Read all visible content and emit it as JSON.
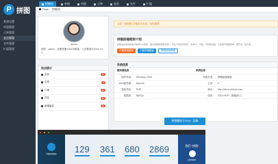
{
  "brand": {
    "name": "拼图"
  },
  "nav": [
    {
      "label": "控制台",
      "active": true
    },
    {
      "label": "系统",
      "active": false
    },
    {
      "label": "内容",
      "active": false
    },
    {
      "label": "订单",
      "active": false
    },
    {
      "label": "会员",
      "active": false
    },
    {
      "label": "文件",
      "active": false
    },
    {
      "label": "扩展",
      "active": false
    }
  ],
  "sidebar": [
    {
      "label": "系统设置",
      "active": false
    },
    {
      "label": "内容管理",
      "active": false
    },
    {
      "label": "订单管理",
      "active": false
    },
    {
      "label": "会员管理",
      "active": true
    },
    {
      "label": "文件管理",
      "active": false
    },
    {
      "label": "扩展管理",
      "active": false
    }
  ],
  "tabs": [
    {
      "label": "Plate"
    },
    {
      "label": "控制台"
    }
  ],
  "user": {
    "name": "admin",
    "welcome": "您好，admin，这是您第1000次登录，上次登录为2014-10-1。"
  },
  "stats": {
    "title": "站点统计",
    "rows": [
      {
        "label": "会员",
        "badge": "99"
      },
      {
        "label": "文章",
        "badge": "8"
      },
      {
        "label": "订单",
        "badge": "88"
      },
      {
        "label": "评论",
        "badge": "99"
      },
      {
        "label": "新增留言",
        "badge": "99"
      }
    ]
  },
  "notice": "注意：您是第1次使用本系统，祝您愉快。",
  "intro": {
    "title": "拼图前端框架介绍",
    "text": "拼图是优秀的响应式前端CSS框架，国内前端框架排名前5，专注于响应式布局，支持PC、平板、手机等设备，让前端开发更简单、更高效、更方便。",
    "buttons": [
      "下载拼图框架",
      "下载拼图模板",
      "拼图使用教程"
    ]
  },
  "system": {
    "title": "系统信息",
    "headers": [
      "服务器信息",
      "系统信息"
    ],
    "rows": [
      {
        "k1": "操作系统：",
        "v1": "Windows 2008",
        "k2": "系统开发：",
        "v2": "拼图前端框架"
      },
      {
        "k1": "Web服务器：",
        "v1": "Apache",
        "k2": "主页：",
        "v2": "#"
      },
      {
        "k1": "程序语言：",
        "v1": "PHP",
        "k2": "演示：",
        "v2": "http://demo.pintuer.com"
      },
      {
        "k1": "数据库：",
        "v1": "MySQL",
        "k2": "版权：",
        "v2": "2015 HDFI（单独改入）"
      }
    ]
  },
  "tooltip": "拼图服务于2015 · 后端",
  "preview": {
    "numbers": [
      "129",
      "361",
      "680",
      "2869"
    ],
    "logo_text": "拼图前端框架",
    "right_title": "我们 \"拼图\"",
    "right_sub": "pintuer"
  }
}
